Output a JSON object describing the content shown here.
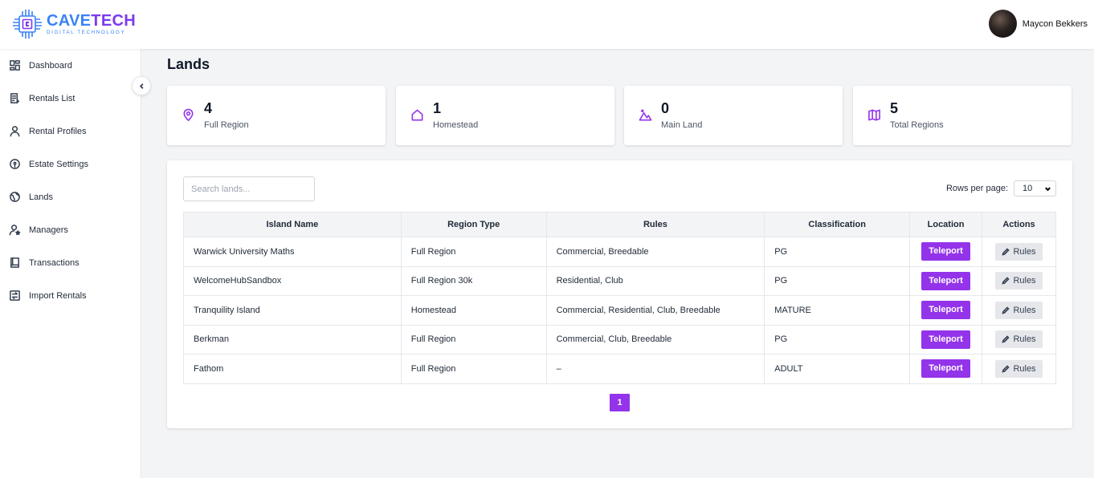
{
  "brand": {
    "name_part1": "CAVE",
    "name_part2": "TECH",
    "tagline": "DIGITAL TECHNOLOGY"
  },
  "user": {
    "name": "Maycon Bekkers"
  },
  "sidebar": {
    "items": [
      {
        "label": "Dashboard",
        "icon": "dashboard-icon"
      },
      {
        "label": "Rentals List",
        "icon": "list-icon"
      },
      {
        "label": "Rental Profiles",
        "icon": "user-icon"
      },
      {
        "label": "Estate Settings",
        "icon": "map-pin-icon"
      },
      {
        "label": "Lands",
        "icon": "globe-icon"
      },
      {
        "label": "Managers",
        "icon": "user-star-icon"
      },
      {
        "label": "Transactions",
        "icon": "book-icon"
      },
      {
        "label": "Import Rentals",
        "icon": "import-icon"
      }
    ]
  },
  "page": {
    "title": "Lands"
  },
  "stats": [
    {
      "value": "4",
      "label": "Full Region",
      "icon": "map-pin-icon"
    },
    {
      "value": "1",
      "label": "Homestead",
      "icon": "home-icon"
    },
    {
      "value": "0",
      "label": "Main Land",
      "icon": "mountain-icon"
    },
    {
      "value": "5",
      "label": "Total Regions",
      "icon": "map-icon"
    }
  ],
  "table": {
    "search_placeholder": "Search lands...",
    "rows_per_page_label": "Rows per page:",
    "rows_per_page_value": "10",
    "columns": [
      "Island Name",
      "Region Type",
      "Rules",
      "Classification",
      "Location",
      "Actions"
    ],
    "rows": [
      {
        "name": "Warwick University Maths",
        "region_type": "Full Region",
        "rules": "Commercial, Breedable",
        "classification": "PG"
      },
      {
        "name": "WelcomeHubSandbox",
        "region_type": "Full Region 30k",
        "rules": "Residential, Club",
        "classification": "PG"
      },
      {
        "name": "Tranquility Island",
        "region_type": "Homestead",
        "rules": "Commercial, Residential, Club, Breedable",
        "classification": "MATURE"
      },
      {
        "name": "Berkman",
        "region_type": "Full Region",
        "rules": "Commercial, Club, Breedable",
        "classification": "PG"
      },
      {
        "name": "Fathom",
        "region_type": "Full Region",
        "rules": "–",
        "classification": "ADULT"
      }
    ],
    "teleport_label": "Teleport",
    "rules_label": "Rules"
  },
  "pagination": {
    "current": "1"
  },
  "colors": {
    "accent": "#9333ea",
    "brand_blue": "#3b82f6"
  }
}
